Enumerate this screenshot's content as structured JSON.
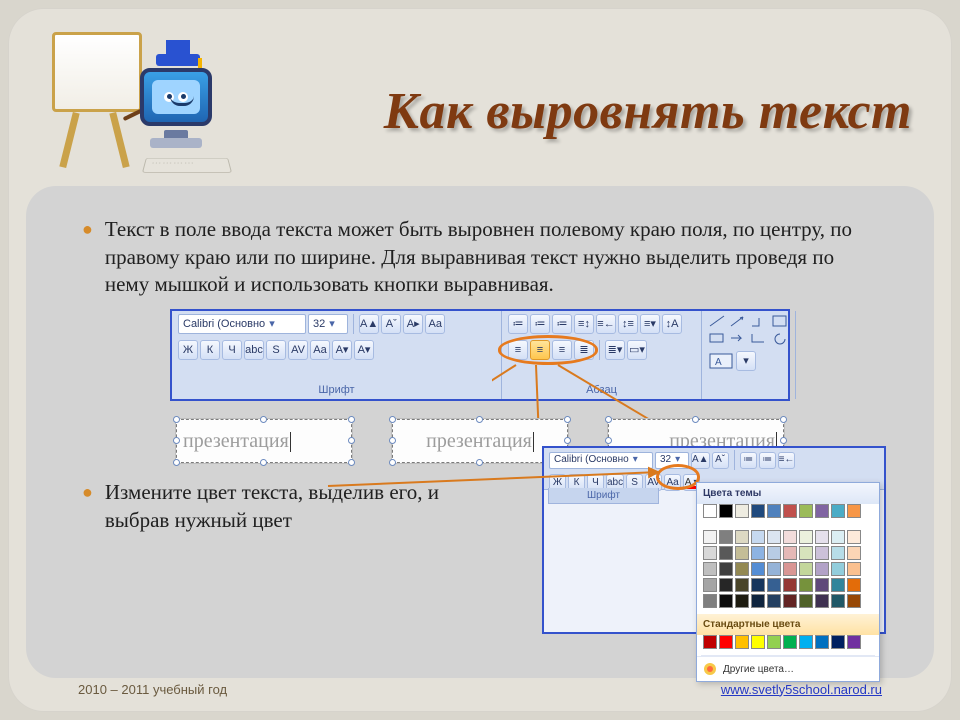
{
  "title": "Как выровнять текст",
  "bullets": {
    "p1": "Текст в поле ввода текста может быть выровнен полевому краю поля, по центру, по правому краю или по ширине. Для выравнивая текст нужно выделить проведя по нему мышкой и использовать кнопки выравнивая.",
    "p2": "Измените цвет текста, выделив его, и выбрав нужный цвет"
  },
  "ribbon": {
    "font_combo": "Calibri (Основно",
    "size_combo": "32",
    "group_font": "Шрифт",
    "group_para": "Абзац",
    "btns_font_row1": [
      "A▲",
      "Aˇ",
      "A▸",
      "Aa"
    ],
    "btns_font_row2": [
      "Ж",
      "К",
      "Ч",
      "abc",
      "S",
      "AV",
      "Aa",
      "A▾",
      "A▾"
    ],
    "btns_para_row1": [
      "≔",
      "≔",
      "≔",
      "≡↕",
      "≡←",
      "↕≡",
      "≡▾",
      "↕A"
    ],
    "btns_para_row2_align": [
      "≡",
      "≡",
      "≡",
      "≣"
    ],
    "btns_para_row2_tail": [
      "≣▾",
      "▭▾"
    ]
  },
  "textboxes": {
    "label": "презентация"
  },
  "mini": {
    "font_combo": "Calibri (Основно",
    "size_combo": "32",
    "group_font": "Шрифт",
    "palette_title1": "Цвета темы",
    "palette_title2": "Стандартные цвета",
    "more_colors": "Другие цвета…"
  },
  "theme_colors": [
    "#ffffff",
    "#000000",
    "#eeece1",
    "#1f497d",
    "#4f81bd",
    "#c0504d",
    "#9bbb59",
    "#8064a2",
    "#4bacc6",
    "#f79646"
  ],
  "theme_tints": [
    [
      "#f2f2f2",
      "#7f7f7f",
      "#ddd9c3",
      "#c6d9f0",
      "#dbe5f1",
      "#f2dcdb",
      "#ebf1dd",
      "#e5e0ec",
      "#dbeef3",
      "#fdeada"
    ],
    [
      "#d8d8d8",
      "#595959",
      "#c4bd97",
      "#8db3e2",
      "#b8cce4",
      "#e5b9b7",
      "#d7e3bc",
      "#ccc1d9",
      "#b7dde8",
      "#fbd5b5"
    ],
    [
      "#bfbfbf",
      "#3f3f3f",
      "#938953",
      "#548dd4",
      "#95b3d7",
      "#d99694",
      "#c3d69b",
      "#b2a2c7",
      "#92cddc",
      "#fac08f"
    ],
    [
      "#a5a5a5",
      "#262626",
      "#494429",
      "#17365d",
      "#366092",
      "#953734",
      "#76923c",
      "#5f497a",
      "#31859b",
      "#e36c09"
    ],
    [
      "#7f7f7f",
      "#0c0c0c",
      "#1d1b10",
      "#0f243e",
      "#244061",
      "#632423",
      "#4f6128",
      "#3f3151",
      "#205867",
      "#974806"
    ]
  ],
  "standard_colors": [
    "#c00000",
    "#ff0000",
    "#ffc000",
    "#ffff00",
    "#92d050",
    "#00b050",
    "#00b0f0",
    "#0070c0",
    "#002060",
    "#7030a0"
  ],
  "footer": {
    "year": "2010 – 2011 учебный год",
    "link": "www.svetly5school.narod.ru"
  }
}
